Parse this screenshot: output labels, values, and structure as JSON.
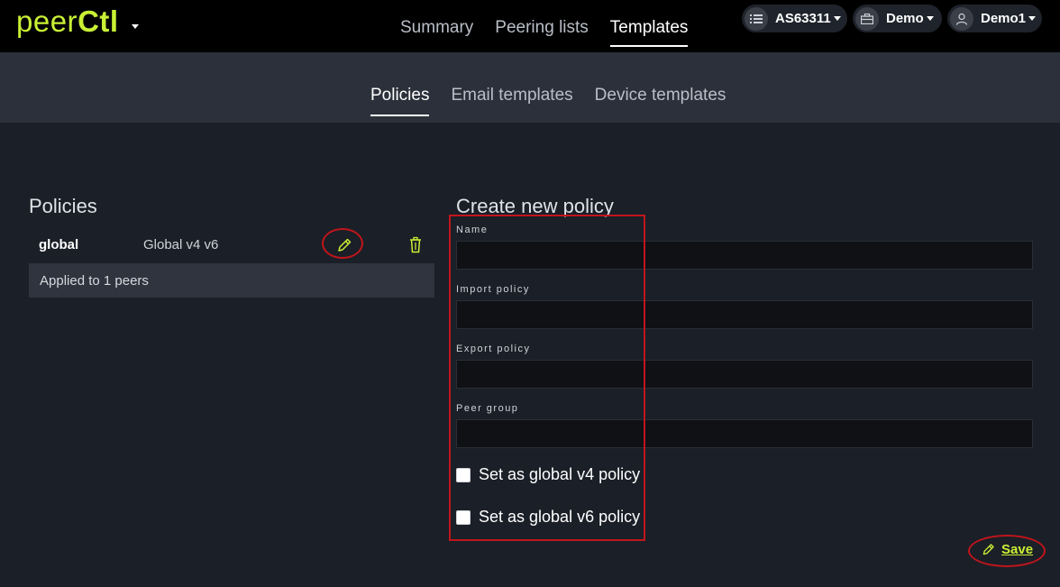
{
  "brand": {
    "logo_text": "peer",
    "logo_text_b": "Ctl"
  },
  "main_nav": {
    "tabs": [
      "Summary",
      "Peering lists",
      "Templates"
    ],
    "active": "Templates"
  },
  "account_menus": {
    "asn": "AS63311",
    "org": "Demo",
    "user": "Demo1"
  },
  "sub_nav": {
    "tabs": [
      "Policies",
      "Email templates",
      "Device templates"
    ],
    "active": "Policies"
  },
  "policies_panel": {
    "title": "Policies",
    "items": [
      {
        "name": "global",
        "description": "Global v4 v6",
        "applied_text": "Applied to 1 peers"
      }
    ]
  },
  "create_form": {
    "title": "Create new policy",
    "fields": {
      "name": "Name",
      "import_policy": "Import policy",
      "export_policy": "Export policy",
      "peer_group": "Peer group"
    },
    "checkboxes": {
      "global_v4": "Set as global v4 policy",
      "global_v6": "Set as global v6 policy"
    },
    "save_label": "Save"
  },
  "colors": {
    "accent": "#c8f034",
    "annotation": "#c0151c",
    "background": "#1b1f27",
    "topbar": "#000000",
    "subnav": "#2b303a"
  },
  "icons": [
    "list-icon",
    "briefcase-icon",
    "user-icon",
    "pencil-icon",
    "trash-icon"
  ]
}
